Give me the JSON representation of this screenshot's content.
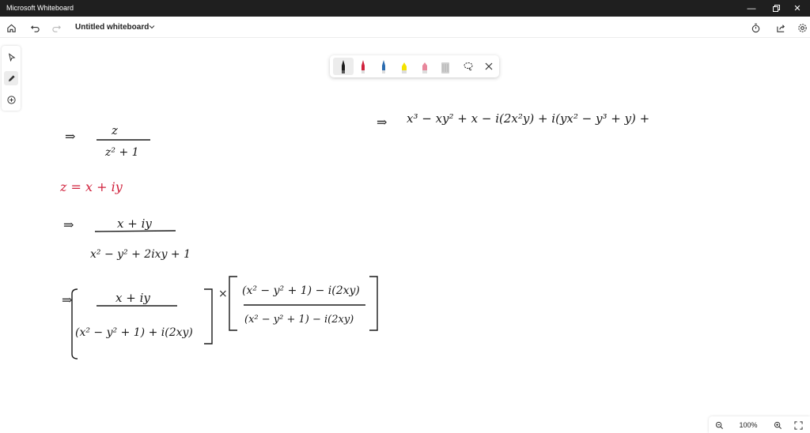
{
  "window": {
    "title": "Microsoft Whiteboard"
  },
  "toolbar": {
    "board_name": "Untitled whiteboard"
  },
  "pen_tray": {
    "pens": [
      {
        "name": "black-pen",
        "color": "#1a1a1a"
      },
      {
        "name": "red-pen",
        "color": "#d0213c"
      },
      {
        "name": "blue-pen",
        "color": "#2b6cb0"
      },
      {
        "name": "yellow-highlighter",
        "color": "#f4e200"
      },
      {
        "name": "pink-pen",
        "color": "#e8879c"
      },
      {
        "name": "eraser",
        "color": "#cfcfcf"
      }
    ]
  },
  "zoom": {
    "level": "100%"
  },
  "colors": {
    "titlebar": "#1f1f1f",
    "ink_black": "#1a1a1a",
    "ink_red": "#d0213c"
  },
  "ink": {
    "line1_arrow": "⇒",
    "line1_num": "z",
    "line1_den": "z² + 1",
    "line2": "z = x + iy",
    "line3_arrow": "⇒",
    "line3_num": "x + iy",
    "line3_den": "x² − y² + 2ixy + 1",
    "line4_arrow": "⇒",
    "line4_num": "x + iy",
    "line4_den": "(x² − y² + 1) + i(2xy)",
    "line4_times": "×",
    "line4_num2": "(x² − y² + 1) − i(2xy)",
    "line4_den2": "(x² − y² + 1) − i(2xy)",
    "right_arrow": "⇒",
    "right_expr": "x³ − xy² + x − i(2x²y) + i(yx² − y³ + y) +"
  }
}
